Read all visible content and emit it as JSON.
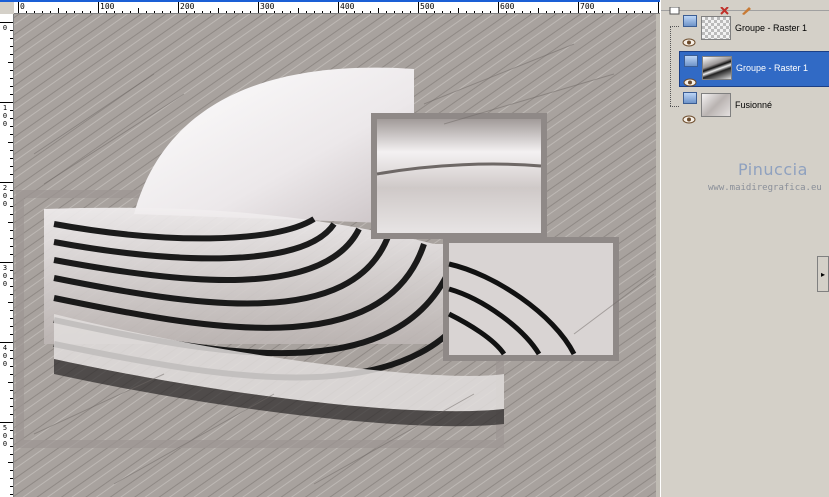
{
  "ruler": {
    "top_labels": [
      "0",
      "100",
      "200",
      "300",
      "400",
      "500",
      "600",
      "700"
    ],
    "left_labels": [
      "0",
      "1\n0\n0",
      "2\n0\n0",
      "3\n0\n0",
      "4\n0\n0",
      "5\n0\n0"
    ]
  },
  "layers": [
    {
      "name": "Groupe - Raster 1",
      "selected": false,
      "icon": "layer-group-icon"
    },
    {
      "name": "Groupe - Raster 1",
      "selected": true,
      "icon": "layer-group-icon"
    },
    {
      "name": "Fusionné",
      "selected": false,
      "icon": "layer-icon"
    }
  ],
  "watermark": {
    "name": "Pinuccia",
    "url": "www.maidiregrafica.eu"
  },
  "colors": {
    "selection": "#316ac5",
    "canvas_bg": "#a7a19d",
    "ruler_accent": "#1a5fd6"
  }
}
